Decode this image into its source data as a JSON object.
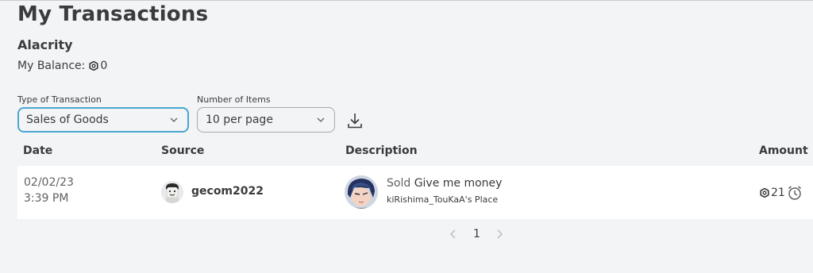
{
  "page": {
    "title": "My Transactions",
    "group_name": "Alacrity",
    "balance_label": "My Balance:",
    "balance_value": "0"
  },
  "filters": {
    "type_label": "Type of Transaction",
    "type_value": "Sales of Goods",
    "items_label": "Number of Items",
    "items_value": "10 per page"
  },
  "table": {
    "columns": [
      "Date",
      "Source",
      "Description",
      "Amount"
    ],
    "rows": [
      {
        "date": "02/02/23",
        "time": "3:39 PM",
        "source": "gecom2022",
        "description_prefix": "Sold",
        "item_name": "Give me money",
        "place": "kiRishima_TouKaA's Place",
        "amount": "21"
      }
    ]
  },
  "pagination": {
    "current_page": "1"
  },
  "icons": {
    "currency": "robux-icon",
    "download": "download-icon",
    "pending": "clock-icon",
    "dropdown": "chevron-down-icon"
  },
  "colors": {
    "focus_border": "#4aa6d3",
    "text": "#393b3d",
    "background": "#f2f4f5"
  }
}
